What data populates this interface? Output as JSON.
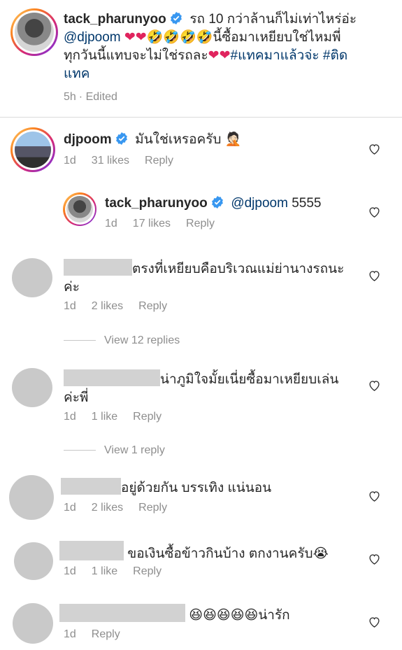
{
  "post": {
    "username": "tack_pharunyoo",
    "caption_line1": "รถ 10 กว่าล้านก็ไม่เท่าไหร่อ่ะ",
    "caption_mention": "@djpoom",
    "caption_emojis": "❤❤🤣🤣🤣🤣",
    "caption_line2_text": "นี้ซื้อมาเหยียบใช่ไหมพี่",
    "caption_line3_text": "ทุกวันนี้แทบจะไม่ใช่รถละ",
    "caption_line3_emojis": "❤❤",
    "hashtag1": "#แทคมาแล้วจ่ะ",
    "hashtag2_part1": "#ติด",
    "hashtag2_part2": "แทค",
    "time": "5h",
    "edited": "· Edited"
  },
  "comments": [
    {
      "username": "djpoom",
      "text": "มันใช่เหรอครับ 🤦🏻",
      "time": "1d",
      "likes": "31 likes",
      "reply": "Reply"
    },
    {
      "username": "tack_pharunyoo",
      "mention": "@djpoom",
      "text": "5555",
      "time": "1d",
      "likes": "17 likes",
      "reply": "Reply"
    },
    {
      "line1": "ตรงที่เหยียบคือบริเวณแม่ย่านางรถนะ",
      "line2": "ค่ะ",
      "time": "1d",
      "likes": "2 likes",
      "reply": "Reply",
      "view_replies": "View 12 replies"
    },
    {
      "line1": "น่าภูมิใจมั้ยเนี่ยซื้อมาเหยียบเล่น",
      "line2": "ค่ะพี่",
      "time": "1d",
      "likes": "1 like",
      "reply": "Reply",
      "view_replies": "View 1 reply"
    },
    {
      "line1": "อยู่ด้วยกัน บรรเทิง แน่นอน",
      "time": "1d",
      "likes": "2 likes",
      "reply": "Reply"
    },
    {
      "line1": "ขอเงินซื้อข้าวกินบ้าง ตกงานครับ😭",
      "time": "1d",
      "likes": "1 like",
      "reply": "Reply"
    },
    {
      "line1": "😆😆😆😆😆น่ารัก",
      "time": "1d",
      "reply": "Reply"
    }
  ],
  "colors": {
    "verified": "#3897f0",
    "link": "#00376b",
    "meta": "#8e8e8e"
  }
}
